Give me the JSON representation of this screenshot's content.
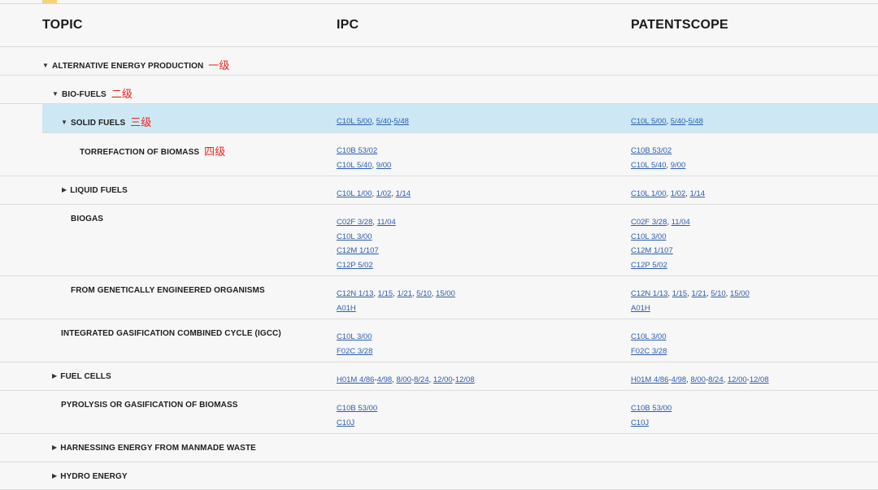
{
  "header": {
    "topic": "TOPIC",
    "ipc": "IPC",
    "patentscope": "PATENTSCOPE"
  },
  "rows": [
    {
      "id": "alt",
      "label": "ALTERNATIVE ENERGY PRODUCTION",
      "caret": "down",
      "annotation": "一级",
      "ipc": [],
      "ps": []
    },
    {
      "id": "bio",
      "label": "BIO-FUELS",
      "caret": "down",
      "annotation": "二级",
      "ipc": [],
      "ps": []
    },
    {
      "id": "solid",
      "label": "SOLID FUELS",
      "caret": "down",
      "annotation": "三级",
      "active": true,
      "ipc": [
        [
          [
            "C10L 5/00"
          ],
          ", ",
          [
            "5/40"
          ],
          "-",
          [
            "5/48"
          ]
        ]
      ],
      "ps": [
        [
          [
            "C10L 5/00"
          ],
          ", ",
          [
            "5/40"
          ],
          "-",
          [
            "5/48"
          ]
        ]
      ]
    },
    {
      "id": "torr",
      "label": "TORREFACTION OF BIOMASS",
      "annotation": "四级",
      "ipc": [
        [
          [
            "C10B 53/02"
          ]
        ],
        [
          [
            "C10L 5/40"
          ],
          ", ",
          [
            "9/00"
          ]
        ]
      ],
      "ps": [
        [
          [
            "C10B 53/02"
          ]
        ],
        [
          [
            "C10L 5/40"
          ],
          ", ",
          [
            "9/00"
          ]
        ]
      ]
    },
    {
      "id": "liquid",
      "label": "LIQUID FUELS",
      "caret": "right",
      "ipc": [
        [
          [
            "C10L 1/00"
          ],
          ", ",
          [
            "1/02"
          ],
          ", ",
          [
            "1/14"
          ]
        ]
      ],
      "ps": [
        [
          [
            "C10L 1/00"
          ],
          ", ",
          [
            "1/02"
          ],
          ", ",
          [
            "1/14"
          ]
        ]
      ]
    },
    {
      "id": "biogas",
      "label": "BIOGAS",
      "ipc": [
        [
          [
            "C02F 3/28"
          ],
          ", ",
          [
            "11/04"
          ]
        ],
        [
          [
            "C10L 3/00"
          ]
        ],
        [
          [
            "C12M 1/107"
          ]
        ],
        [
          [
            "C12P 5/02"
          ]
        ]
      ],
      "ps": [
        [
          [
            "C02F 3/28"
          ],
          ", ",
          [
            "11/04"
          ]
        ],
        [
          [
            "C10L 3/00"
          ]
        ],
        [
          [
            "C12M 1/107"
          ]
        ],
        [
          [
            "C12P 5/02"
          ]
        ]
      ]
    },
    {
      "id": "gmo",
      "label": "FROM GENETICALLY ENGINEERED ORGANISMS",
      "ipc": [
        [
          [
            "C12N 1/13"
          ],
          ", ",
          [
            "1/15"
          ],
          ", ",
          [
            "1/21"
          ],
          ", ",
          [
            "5/10"
          ],
          ", ",
          [
            "15/00"
          ]
        ],
        [
          [
            "A01H"
          ]
        ]
      ],
      "ps": [
        [
          [
            "C12N 1/13"
          ],
          ", ",
          [
            "1/15"
          ],
          ", ",
          [
            "1/21"
          ],
          ", ",
          [
            "5/10"
          ],
          ", ",
          [
            "15/00"
          ]
        ],
        [
          [
            "A01H"
          ]
        ]
      ]
    },
    {
      "id": "igcc",
      "label": "INTEGRATED GASIFICATION COMBINED CYCLE (IGCC)",
      "ipc": [
        [
          [
            "C10L 3/00"
          ]
        ],
        [
          [
            "F02C 3/28"
          ]
        ]
      ],
      "ps": [
        [
          [
            "C10L 3/00"
          ]
        ],
        [
          [
            "F02C 3/28"
          ]
        ]
      ]
    },
    {
      "id": "fuelcells",
      "label": "FUEL CELLS",
      "caret": "right",
      "ipc": [
        [
          [
            "H01M 4/86"
          ],
          "-",
          [
            "4/98"
          ],
          ", ",
          [
            "8/00"
          ],
          "-",
          [
            "8/24"
          ],
          ", ",
          [
            "12/00"
          ],
          "-",
          [
            "12/08"
          ]
        ]
      ],
      "ps": [
        [
          [
            "H01M 4/86"
          ],
          "-",
          [
            "4/98"
          ],
          ", ",
          [
            "8/00"
          ],
          "-",
          [
            "8/24"
          ],
          ", ",
          [
            "12/00"
          ],
          "-",
          [
            "12/08"
          ]
        ]
      ]
    },
    {
      "id": "pyro",
      "label": "PYROLYSIS OR GASIFICATION OF BIOMASS",
      "ipc": [
        [
          [
            "C10B 53/00"
          ]
        ],
        [
          [
            "C10J"
          ]
        ]
      ],
      "ps": [
        [
          [
            "C10B 53/00"
          ]
        ],
        [
          [
            "C10J"
          ]
        ]
      ]
    },
    {
      "id": "waste",
      "label": "HARNESSING ENERGY FROM MANMADE WASTE",
      "caret": "right",
      "ipc": [],
      "ps": []
    },
    {
      "id": "hydro",
      "label": "HYDRO ENERGY",
      "caret": "right",
      "ipc": [],
      "ps": []
    }
  ]
}
